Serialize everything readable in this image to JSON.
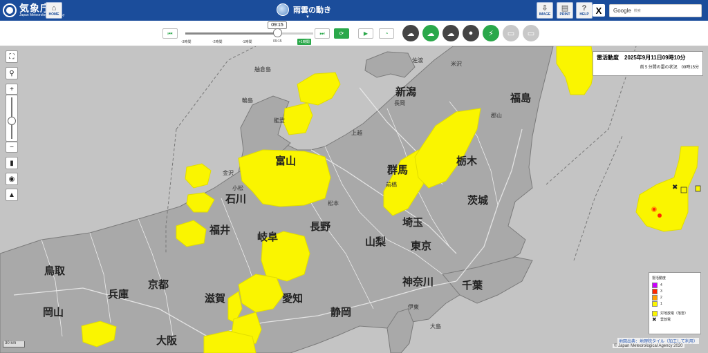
{
  "header": {
    "logo_main": "気象庁",
    "logo_sub": "Japan Meteorological Agency",
    "home_label": "HOME",
    "title": "雨雲の動き",
    "image_label": "IMAGE",
    "print_label": "PRINT",
    "help_label": "HELP",
    "x_label": "X",
    "search_value": "Google",
    "search_placeholder": "検索"
  },
  "timeline": {
    "current_time": "09:15",
    "labels": [
      "-3時間",
      "-2時間",
      "-1時間",
      "09:15"
    ],
    "plus_label": "+1時間",
    "position_fraction": 0.72
  },
  "layers": [
    {
      "name": "rain-cloud-icon",
      "glyph": "☁",
      "color": "#444444"
    },
    {
      "name": "cloud-up-icon",
      "glyph": "☁",
      "color": "#2aa84a"
    },
    {
      "name": "cloud-rain-icon",
      "glyph": "☁",
      "color": "#444444"
    },
    {
      "name": "drop-icon",
      "glyph": "●",
      "color": "#444444"
    },
    {
      "name": "lightning-icon",
      "glyph": "⚡",
      "color": "#2aa84a"
    },
    {
      "name": "sign-icon",
      "glyph": "▭",
      "color": "#c8c8c8"
    },
    {
      "name": "road-icon",
      "glyph": "▭",
      "color": "#c8c8c8"
    }
  ],
  "info": {
    "title": "雷活動度　2025年9月11日09時10分",
    "subtitle": "前５分間の雷の状況　09時15分"
  },
  "legend": {
    "title": "雷活動度",
    "levels": [
      {
        "label": "4",
        "color": "#cc00ff"
      },
      {
        "label": "3",
        "color": "#ff2800"
      },
      {
        "label": "2",
        "color": "#ffa000"
      },
      {
        "label": "1",
        "color": "#faf500"
      }
    ],
    "strike_label": "対地放電（落雷）",
    "cloud_label": "雲放電"
  },
  "prefectures": [
    {
      "label": "新潟"
    },
    {
      "label": "福島"
    },
    {
      "label": "石川"
    },
    {
      "label": "富山"
    },
    {
      "label": "長野"
    },
    {
      "label": "群馬"
    },
    {
      "label": "栃木"
    },
    {
      "label": "茨城"
    },
    {
      "label": "埼玉"
    },
    {
      "label": "福井"
    },
    {
      "label": "岐阜"
    },
    {
      "label": "山梨"
    },
    {
      "label": "東京"
    },
    {
      "label": "千葉"
    },
    {
      "label": "神奈川"
    },
    {
      "label": "静岡"
    },
    {
      "label": "愛知"
    },
    {
      "label": "滋賀"
    },
    {
      "label": "京都"
    },
    {
      "label": "兵庫"
    },
    {
      "label": "鳥取"
    },
    {
      "label": "岡山"
    },
    {
      "label": "大阪"
    }
  ],
  "cities": [
    {
      "label": "輪島"
    },
    {
      "label": "能登"
    },
    {
      "label": "金沢"
    },
    {
      "label": "小松"
    },
    {
      "label": "長岡"
    },
    {
      "label": "上越"
    },
    {
      "label": "米沢"
    },
    {
      "label": "郡山"
    },
    {
      "label": "前橋"
    },
    {
      "label": "松本"
    },
    {
      "label": "伊東"
    },
    {
      "label": "大島"
    },
    {
      "label": "舳倉島"
    },
    {
      "label": "佐渡"
    }
  ],
  "map": {
    "scale_label": "30 km",
    "credit_source": "地図出典：地理院タイル（加工して利用）",
    "credit_copyright": "© Japan Meteorological Agency 2020"
  },
  "map_controls": [
    "fullscreen-icon",
    "location-icon",
    "zoom-in",
    "zoom-slider",
    "zoom-out",
    "map-book-icon",
    "drop-icon",
    "mountain-icon"
  ]
}
